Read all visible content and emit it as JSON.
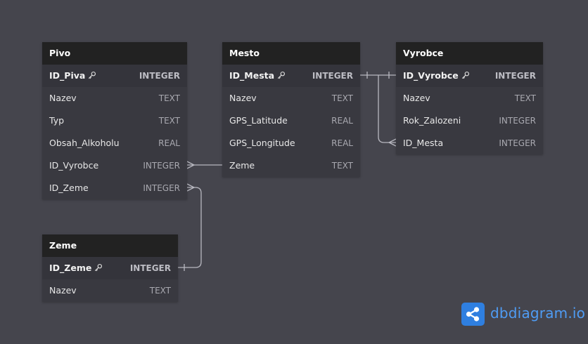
{
  "tables": {
    "pivo": {
      "title": "Pivo",
      "fields": [
        {
          "name": "ID_Piva",
          "type": "INTEGER",
          "pk": true
        },
        {
          "name": "Nazev",
          "type": "TEXT"
        },
        {
          "name": "Typ",
          "type": "TEXT"
        },
        {
          "name": "Obsah_Alkoholu",
          "type": "REAL"
        },
        {
          "name": "ID_Vyrobce",
          "type": "INTEGER"
        },
        {
          "name": "ID_Zeme",
          "type": "INTEGER"
        }
      ]
    },
    "mesto": {
      "title": "Mesto",
      "fields": [
        {
          "name": "ID_Mesta",
          "type": "INTEGER",
          "pk": true
        },
        {
          "name": "Nazev",
          "type": "TEXT"
        },
        {
          "name": "GPS_Latitude",
          "type": "REAL"
        },
        {
          "name": "GPS_Longitude",
          "type": "REAL"
        },
        {
          "name": "Zeme",
          "type": "TEXT"
        }
      ]
    },
    "vyrobce": {
      "title": "Vyrobce",
      "fields": [
        {
          "name": "ID_Vyrobce",
          "type": "INTEGER",
          "pk": true
        },
        {
          "name": "Nazev",
          "type": "TEXT"
        },
        {
          "name": "Rok_Zalozeni",
          "type": "INTEGER"
        },
        {
          "name": "ID_Mesta",
          "type": "INTEGER"
        }
      ]
    },
    "zeme": {
      "title": "Zeme",
      "fields": [
        {
          "name": "ID_Zeme",
          "type": "INTEGER",
          "pk": true
        },
        {
          "name": "Nazev",
          "type": "TEXT"
        }
      ]
    }
  },
  "brand": {
    "name": "dbdiagram",
    "suffix": ".io",
    "icon": "share-icon",
    "color": "#2f7fe0"
  },
  "key_icon": "key-icon"
}
